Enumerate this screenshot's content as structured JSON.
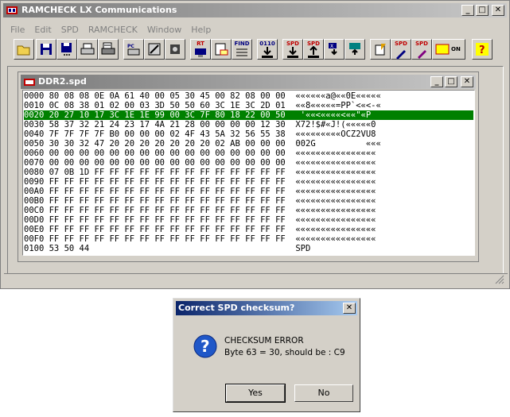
{
  "app": {
    "title": "RAMCHECK LX Communications",
    "window_buttons": [
      "_",
      "□",
      "✕"
    ]
  },
  "menu": [
    "File",
    "Edit",
    "SPD",
    "RAMCHECK",
    "Window",
    "Help"
  ],
  "toolbar": {
    "labels": {
      "rt": "RT",
      "find": "FIND",
      "code": "0110",
      "spd_a": "SPD",
      "spd_b": "SPD",
      "spd_c": "SPD",
      "spd_edit": "SPD",
      "on": "ON",
      "help": "?"
    }
  },
  "child_window": {
    "title": "DDR2.spd",
    "selected_row": 2,
    "rows": [
      "0000 80 08 08 0E 0A 61 40 00 05 30 45 00 82 08 00 00  ««««««a@««0E«««««",
      "0010 0C 08 38 01 02 00 03 3D 50 50 60 3C 1E 3C 2D 01  ««8«««««=PP`<«<-«",
      "0020 20 27 10 17 3C 1E 1E 99 00 3C 7F 80 18 22 00 50   '««<««««<««\"«P",
      "0030 58 37 32 21 24 23 17 4A 21 28 00 00 00 00 12 30  X72!$#«J!(«««««0",
      "0040 7F 7F 7F 7F B0 00 00 00 02 4F 43 5A 32 56 55 38  «««««««««OCZ2VU8",
      "0050 30 30 32 47 20 20 20 20 20 20 20 02 AB 00 00 00  002G          «««",
      "0060 00 00 00 00 00 00 00 00 00 00 00 00 00 00 00 00  ««««««««««««««««",
      "0070 00 00 00 00 00 00 00 00 00 00 00 00 00 00 00 00  ««««««««««««««««",
      "0080 07 0B 1D FF FF FF FF FF FF FF FF FF FF FF FF FF  ««««««««««««««««",
      "0090 FF FF FF FF FF FF FF FF FF FF FF FF FF FF FF FF  ««««««««««««««««",
      "00A0 FF FF FF FF FF FF FF FF FF FF FF FF FF FF FF FF  ««««««««««««««««",
      "00B0 FF FF FF FF FF FF FF FF FF FF FF FF FF FF FF FF  ««««««««««««««««",
      "00C0 FF FF FF FF FF FF FF FF FF FF FF FF FF FF FF FF  ««««««««««««««««",
      "00D0 FF FF FF FF FF FF FF FF FF FF FF FF FF FF FF FF  ««««««««««««««««",
      "00E0 FF FF FF FF FF FF FF FF FF FF FF FF FF FF FF FF  ««««««««««««««««",
      "00F0 FF FF FF FF FF FF FF FF FF FF FF FF FF FF FF FF  ««««««««««««««««",
      "0100 53 50 44                                         SPD"
    ]
  },
  "dialog": {
    "title": "Correct SPD checksum?",
    "close": "✕",
    "message_line1": "CHECKSUM ERROR",
    "message_line2": "Byte 63 = 30, should be : C9",
    "yes_label": "Yes",
    "no_label": "No"
  },
  "colors": {
    "selected_row_bg": "#008000",
    "dialog_title_start": "#0a246a",
    "dialog_title_end": "#a6caf0",
    "inactive_title_start": "#7a7a7a"
  }
}
